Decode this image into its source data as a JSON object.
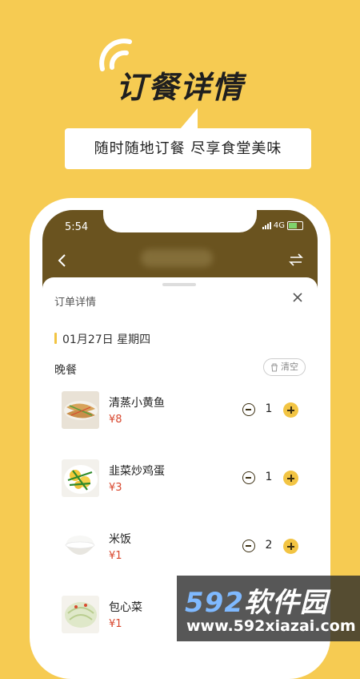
{
  "hero": {
    "title": "订餐详情",
    "subtitle": "随时随地订餐  尽享食堂美味"
  },
  "status_bar": {
    "time": "5:54",
    "network": "4G"
  },
  "sheet": {
    "title": "订单详情",
    "date": "01月27日 星期四",
    "meal": "晚餐",
    "clear_label": "清空"
  },
  "items": [
    {
      "name": "清蒸小黄鱼",
      "price": "¥8",
      "qty": "1",
      "icon": "steamed-fish-photo"
    },
    {
      "name": "韭菜炒鸡蛋",
      "price": "¥3",
      "qty": "1",
      "icon": "chive-egg-photo"
    },
    {
      "name": "米饭",
      "price": "¥1",
      "qty": "2",
      "icon": "rice-photo"
    },
    {
      "name": "包心菜",
      "price": "¥1",
      "qty": "",
      "icon": "cabbage-photo"
    }
  ],
  "watermark": {
    "brand_num": "592",
    "brand_text": "软件园",
    "url": "www.592xiazai.com"
  },
  "colors": {
    "background": "#F6CB52",
    "accent": "#F2C443",
    "header": "#6a531f",
    "price": "#d8462d"
  }
}
